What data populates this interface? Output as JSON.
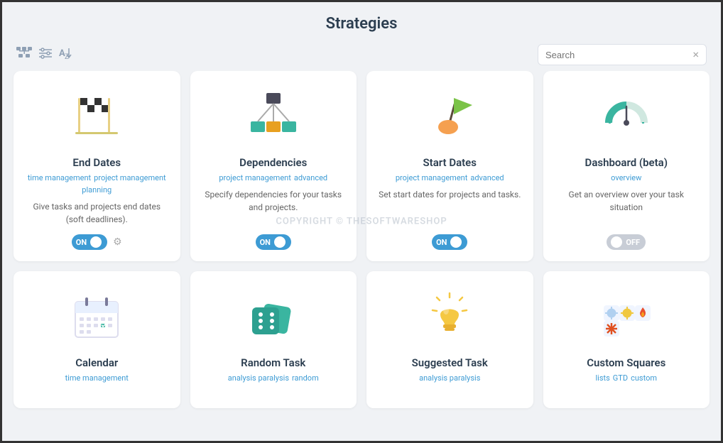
{
  "page": {
    "title": "Strategies"
  },
  "toolbar": {
    "search_placeholder": "Search",
    "clear_label": "×",
    "icons": [
      "hierarchy-icon",
      "settings-icon",
      "sort-icon"
    ]
  },
  "cards": [
    {
      "id": "end-dates",
      "title": "End Dates",
      "tags": [
        "time management",
        "project management",
        "planning"
      ],
      "description": "Give tasks and projects end dates (soft deadlines).",
      "toggle": "on",
      "has_gear": true
    },
    {
      "id": "dependencies",
      "title": "Dependencies",
      "tags": [
        "project management",
        "advanced"
      ],
      "description": "Specify dependencies for your tasks and projects.",
      "toggle": "on",
      "has_gear": false
    },
    {
      "id": "start-dates",
      "title": "Start Dates",
      "tags": [
        "project management",
        "advanced"
      ],
      "description": "Set start dates for projects and tasks.",
      "toggle": "on",
      "has_gear": false
    },
    {
      "id": "dashboard",
      "title": "Dashboard (beta)",
      "tags": [
        "overview"
      ],
      "description": "Get an overview over your task situation",
      "toggle": "off",
      "has_gear": false
    },
    {
      "id": "calendar",
      "title": "Calendar",
      "tags": [
        "time management"
      ],
      "description": "",
      "toggle": null,
      "has_gear": false
    },
    {
      "id": "random-task",
      "title": "Random Task",
      "tags": [
        "analysis paralysis",
        "random"
      ],
      "description": "",
      "toggle": null,
      "has_gear": false
    },
    {
      "id": "suggested-task",
      "title": "Suggested Task",
      "tags": [
        "analysis paralysis"
      ],
      "description": "",
      "toggle": null,
      "has_gear": false
    },
    {
      "id": "custom-squares",
      "title": "Custom Squares",
      "tags": [
        "lists",
        "GTD",
        "custom"
      ],
      "description": "",
      "toggle": null,
      "has_gear": false
    }
  ]
}
